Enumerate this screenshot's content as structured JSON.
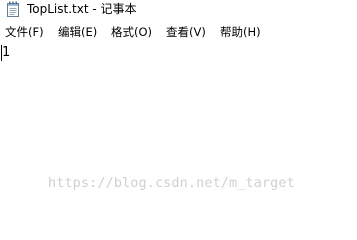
{
  "window": {
    "title": "TopList.txt - 记事本"
  },
  "menubar": {
    "items": [
      {
        "label": "文件(F)"
      },
      {
        "label": "编辑(E)"
      },
      {
        "label": "格式(O)"
      },
      {
        "label": "查看(V)"
      },
      {
        "label": "帮助(H)"
      }
    ]
  },
  "editor": {
    "content": "1"
  },
  "watermark": {
    "text": "https://blog.csdn.net/m_target"
  },
  "icons": {
    "app": "notepad-icon"
  },
  "colors": {
    "background": "#ffffff",
    "text": "#000000",
    "watermark": "#d0d0d0"
  }
}
